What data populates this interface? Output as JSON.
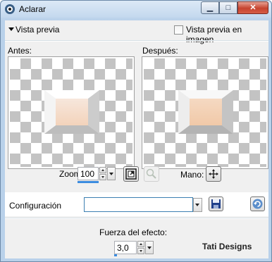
{
  "window": {
    "title": "Aclarar",
    "controls": {
      "minimize": "▁",
      "maximize": "□",
      "close": "✕"
    }
  },
  "preview": {
    "toggle_label": "Vista previa",
    "checkbox_label": "Vista previa en imagen",
    "checkbox_checked": false,
    "before_label": "Antes:",
    "after_label": "Después:"
  },
  "zoom": {
    "label": "Zoom:",
    "value": "100",
    "pan_label": "Mano:"
  },
  "config": {
    "label": "Configuración",
    "value": ""
  },
  "effect": {
    "label": "Fuerza del efecto:",
    "value": "3,0"
  },
  "credit": "Tati Designs",
  "colors": {
    "accent": "#3c8cdf",
    "bevel_face": "#f6dac5",
    "bevel_frame": "#eeeeee",
    "checker": "#c3c3c3"
  },
  "icons": {
    "app": "app-icon",
    "zoom_fit": "fit-window-icon",
    "zoom_tool": "magnifier-icon",
    "pan": "move-cross-icon",
    "save": "floppy-disk-icon",
    "reset": "reset-arrow-icon"
  }
}
